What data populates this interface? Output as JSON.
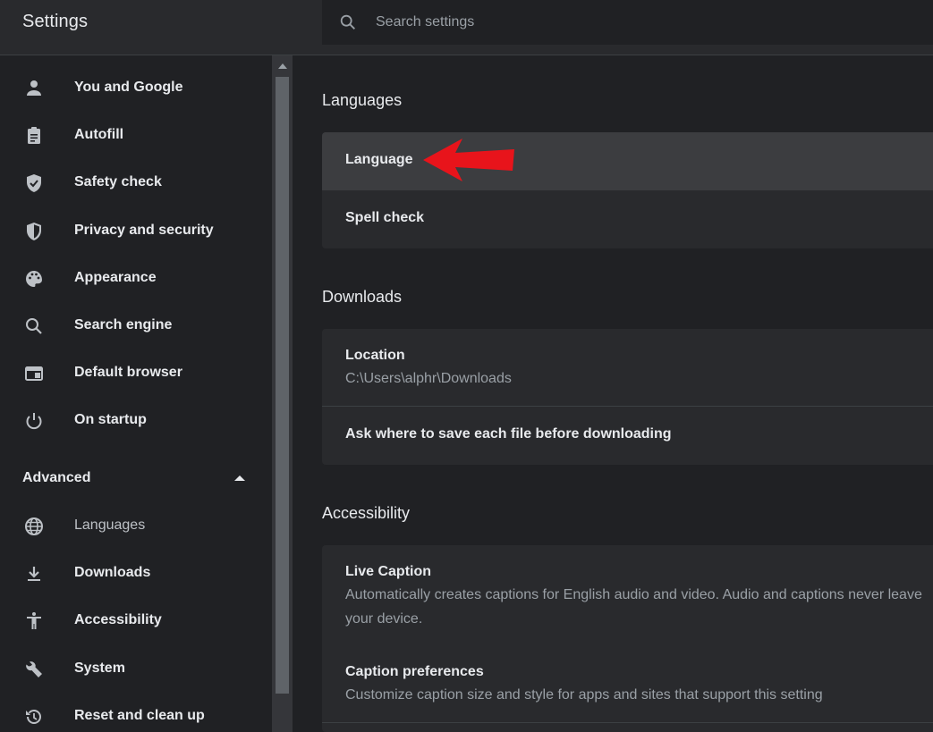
{
  "header": {
    "title": "Settings",
    "search_placeholder": "Search settings"
  },
  "sidebar": {
    "items": [
      {
        "label": "You and Google",
        "icon": "person-icon"
      },
      {
        "label": "Autofill",
        "icon": "clipboard-icon"
      },
      {
        "label": "Safety check",
        "icon": "shield-check-icon"
      },
      {
        "label": "Privacy and security",
        "icon": "shield-icon"
      },
      {
        "label": "Appearance",
        "icon": "palette-icon"
      },
      {
        "label": "Search engine",
        "icon": "search-icon"
      },
      {
        "label": "Default browser",
        "icon": "browser-icon"
      },
      {
        "label": "On startup",
        "icon": "power-icon"
      }
    ],
    "advanced_label": "Advanced",
    "advanced_items": [
      {
        "label": "Languages",
        "icon": "globe-icon"
      },
      {
        "label": "Downloads",
        "icon": "download-icon"
      },
      {
        "label": "Accessibility",
        "icon": "accessibility-icon"
      },
      {
        "label": "System",
        "icon": "wrench-icon"
      },
      {
        "label": "Reset and clean up",
        "icon": "restore-icon"
      }
    ]
  },
  "main": {
    "languages": {
      "title": "Languages",
      "rows": [
        "Language",
        "Spell check"
      ]
    },
    "downloads": {
      "title": "Downloads",
      "location_label": "Location",
      "location_value": "C:\\Users\\alphr\\Downloads",
      "ask_label": "Ask where to save each file before downloading"
    },
    "accessibility": {
      "title": "Accessibility",
      "live_caption_label": "Live Caption",
      "live_caption_desc": "Automatically creates captions for English audio and video. Audio and captions never leave your device.",
      "caption_prefs_label": "Caption preferences",
      "caption_prefs_desc": "Customize caption size and style for apps and sites that support this setting"
    }
  },
  "colors": {
    "background": "#202124",
    "card": "#292a2d",
    "highlight": "#3c3d40",
    "annotation_arrow": "#e8141b"
  }
}
